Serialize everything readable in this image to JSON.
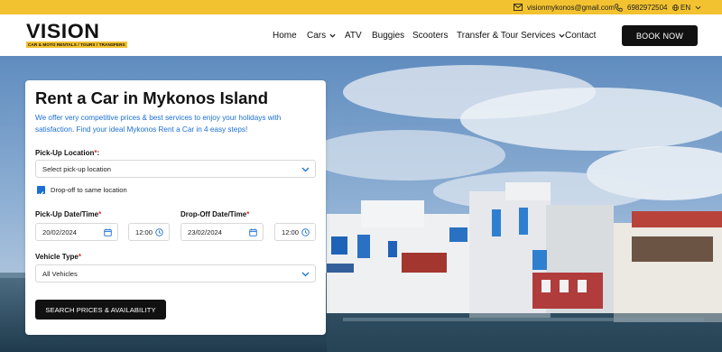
{
  "topbar": {
    "email": "visionmykonos@gmail.com",
    "phone": "6982972504",
    "language": "EN"
  },
  "brand": {
    "name": "VISION",
    "tagline": "CAR & MOTO RENTALS / TOURS / TRANSFERS"
  },
  "nav": {
    "items": [
      "Home",
      "Cars",
      "ATV",
      "Buggies",
      "Scooters",
      "Transfer & Tour Services",
      "Contact"
    ],
    "book_now": "BOOK NOW"
  },
  "form": {
    "title": "Rent a Car in Mykonos Island",
    "subtitle": "We offer very competitive prices & best services to enjoy your holidays with satisfaction. Find your ideal Mykonos Rent a Car in 4 easy steps!",
    "pickup_location_label": "Pick-Up Location",
    "pickup_location_value": "Select pick-up location",
    "dropoff_same_label": "Drop-off to same location",
    "dropoff_same_checked": true,
    "pickup_datetime_label": "Pick-Up Date/Time",
    "pickup_date": "20/02/2024",
    "pickup_time": "12:00",
    "dropoff_datetime_label": "Drop-Off Date/Time",
    "dropoff_date": "23/02/2024",
    "dropoff_time": "12:00",
    "vehicle_type_label": "Vehicle Type",
    "vehicle_type_value": "All Vehicles",
    "required_mark": "*",
    "search_button": "SEARCH PRICES & AVAILABILITY"
  },
  "colors": {
    "accent_yellow": "#f2c230",
    "link_blue": "#1a6fd6",
    "required_red": "#d32f2f",
    "button_black": "#111111"
  },
  "icons": [
    "mail-icon",
    "phone-icon",
    "globe-icon",
    "chevron-down-icon",
    "calendar-icon",
    "clock-icon",
    "checkbox-checked-icon"
  ]
}
